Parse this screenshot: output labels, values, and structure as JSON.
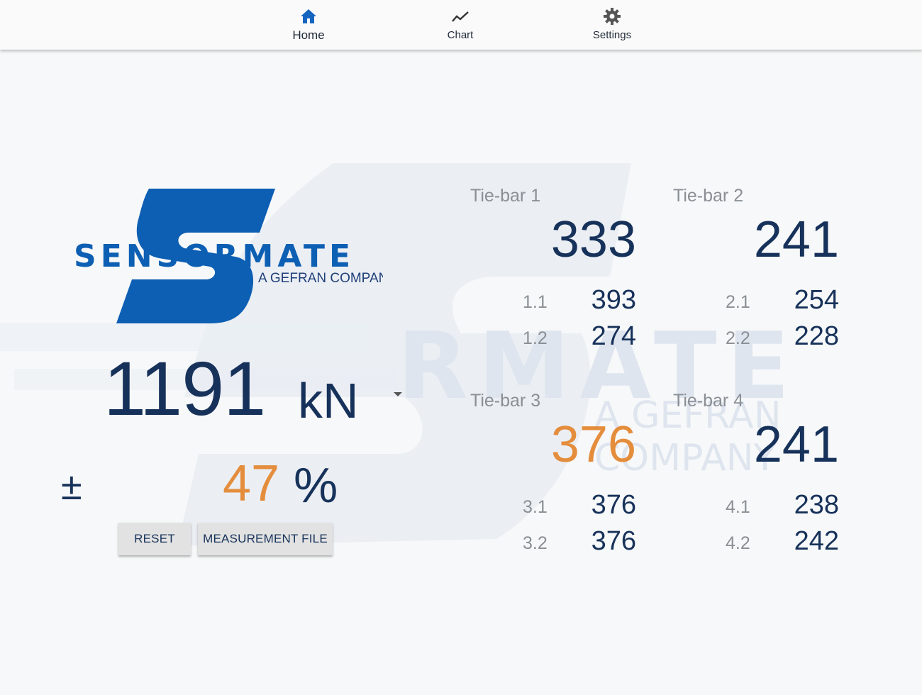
{
  "nav": {
    "items": [
      {
        "label": "Home",
        "icon": "home-icon",
        "active": true
      },
      {
        "label": "Chart",
        "icon": "chart-line-icon",
        "active": false
      },
      {
        "label": "Settings",
        "icon": "gear-icon",
        "active": false
      }
    ]
  },
  "logo": {
    "brand": "SENSORMATE",
    "tagline": "A GEFRAN COMPANY"
  },
  "total": {
    "value": "1191",
    "unit": "kN"
  },
  "deviation": {
    "symbol": "±",
    "value": "47",
    "unit": "%"
  },
  "buttons": {
    "reset": "RESET",
    "measurement_file": "MEASUREMENT FILE"
  },
  "tiebars": [
    {
      "title": "Tie-bar 1",
      "value": "333",
      "alert": false,
      "sensors": [
        {
          "label": "1.1",
          "value": "393"
        },
        {
          "label": "1.2",
          "value": "274"
        }
      ]
    },
    {
      "title": "Tie-bar 2",
      "value": "241",
      "alert": false,
      "sensors": [
        {
          "label": "2.1",
          "value": "254"
        },
        {
          "label": "2.2",
          "value": "228"
        }
      ]
    },
    {
      "title": "Tie-bar 3",
      "value": "376",
      "alert": true,
      "sensors": [
        {
          "label": "3.1",
          "value": "376"
        },
        {
          "label": "3.2",
          "value": "376"
        }
      ]
    },
    {
      "title": "Tie-bar 4",
      "value": "241",
      "alert": false,
      "sensors": [
        {
          "label": "4.1",
          "value": "238"
        },
        {
          "label": "4.2",
          "value": "242"
        }
      ]
    }
  ],
  "colors": {
    "brand_blue": "#0d5fb3",
    "text_navy": "#17325a",
    "alert_orange": "#e48d3c",
    "label_gray": "#8a8f95"
  }
}
